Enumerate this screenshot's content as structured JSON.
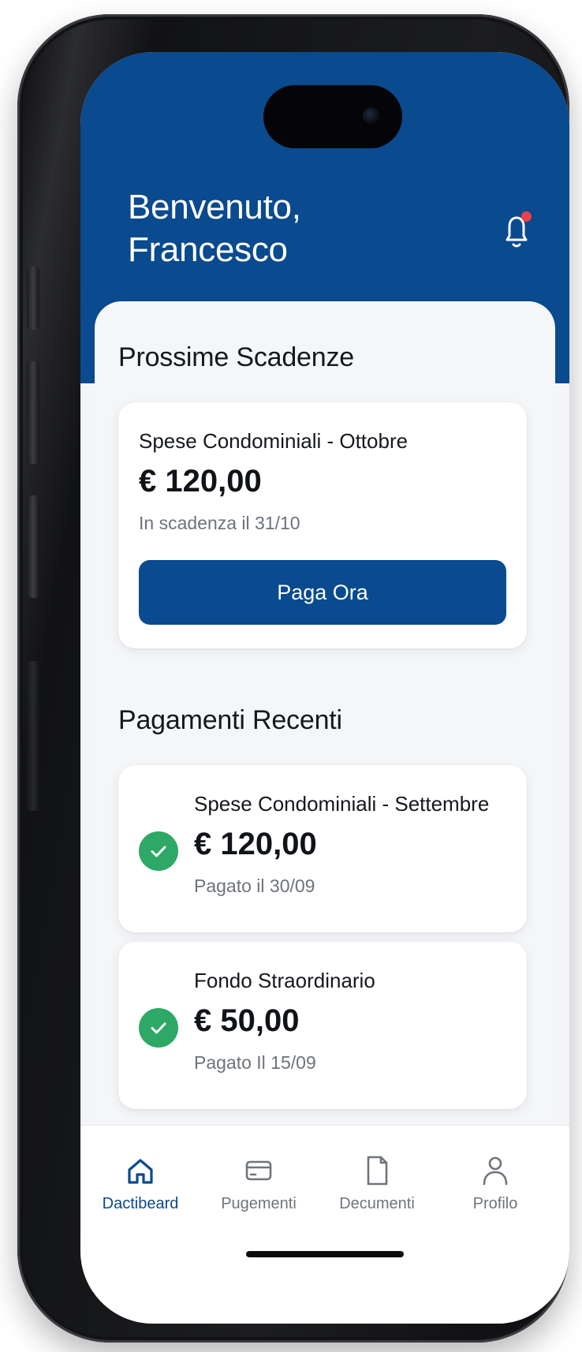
{
  "header": {
    "welcome_line1": "Benvenuto,",
    "welcome_line2": "Francesco",
    "notification_icon": "bell-icon",
    "has_unread_notification": true
  },
  "upcoming": {
    "section_title": "Prossime Scadenze",
    "item": {
      "title": "Spese Condominiali - Ottobre",
      "amount": "€ 120,00",
      "due": "In scadenza il 31/10",
      "action_label": "Paga Ora"
    }
  },
  "recent": {
    "section_title": "Pagamenti Recenti",
    "items": [
      {
        "title": "Spese Condominiali - Settembre",
        "amount": "€ 120,00",
        "paid": "Pagato il 30/09",
        "status_icon": "check-circle-icon"
      },
      {
        "title": "Fondo Straordinario",
        "amount": "€ 50,00",
        "paid": "Pagato Il 15/09",
        "status_icon": "check-circle-icon"
      }
    ]
  },
  "nav": {
    "items": [
      {
        "label": "Dactibeard",
        "icon": "home-icon",
        "active": true
      },
      {
        "label": "Pugementi",
        "icon": "card-icon",
        "active": false
      },
      {
        "label": "Decumenti",
        "icon": "document-icon",
        "active": false
      },
      {
        "label": "Profilo",
        "icon": "user-icon",
        "active": false
      }
    ]
  },
  "colors": {
    "brand": "#0a4a8e",
    "success": "#2ea866",
    "alert": "#e8434a"
  }
}
